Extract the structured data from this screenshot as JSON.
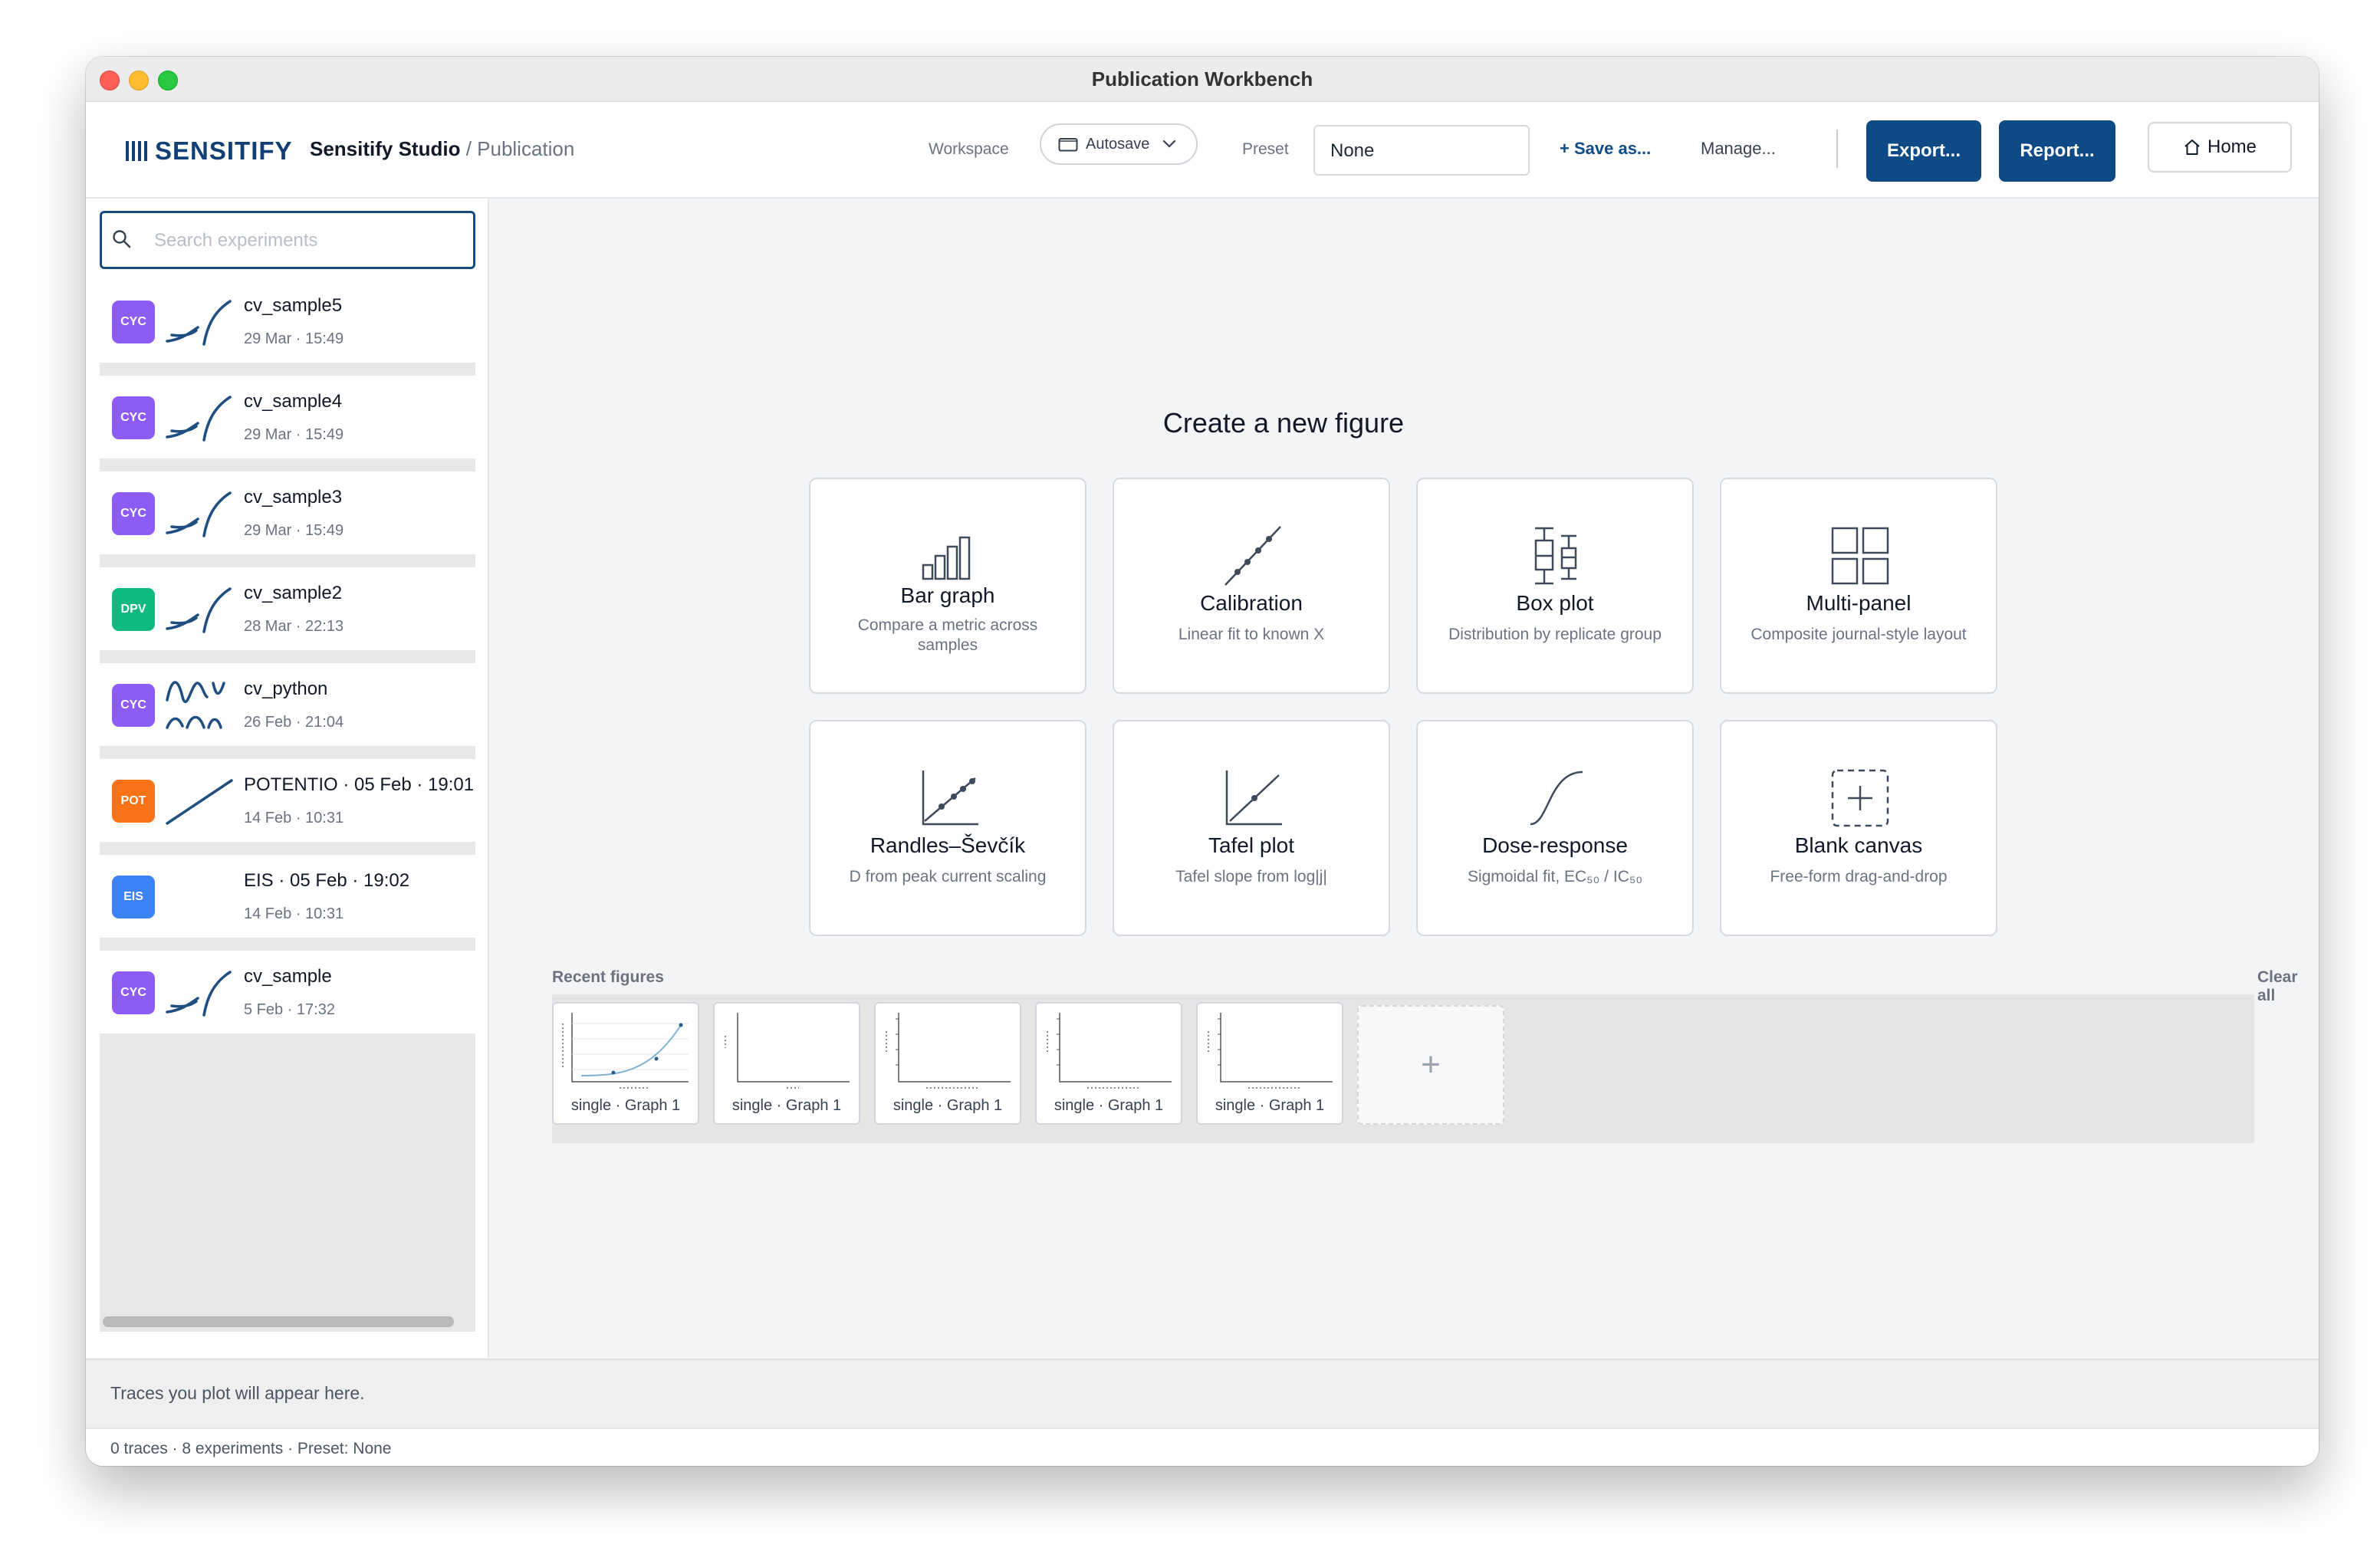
{
  "window": {
    "title": "Publication Workbench"
  },
  "header": {
    "logo_text": "SENSITIFY",
    "breadcrumb_app": "Sensitify Studio",
    "breadcrumb_page": " / Publication",
    "workspace_label": "Workspace",
    "workspace_value": "Autosave",
    "preset_label": "Preset",
    "preset_value": "None",
    "save_as": "+ Save as...",
    "manage": "Manage...",
    "export": "Export...",
    "report": "Report...",
    "home": "Home"
  },
  "sidebar": {
    "search_placeholder": "Search experiments",
    "items": [
      {
        "badge": "CYC",
        "color": "#8b5cf6",
        "icon": "cv-trace-icon",
        "name": "cv_sample5",
        "date": "29 Mar · 15:49"
      },
      {
        "badge": "CYC",
        "color": "#8b5cf6",
        "icon": "cv-trace-icon",
        "name": "cv_sample4",
        "date": "29 Mar · 15:49"
      },
      {
        "badge": "CYC",
        "color": "#8b5cf6",
        "icon": "cv-trace-icon",
        "name": "cv_sample3",
        "date": "29 Mar · 15:49"
      },
      {
        "badge": "DPV",
        "color": "#10b981",
        "icon": "cv-trace-icon",
        "name": "cv_sample2",
        "date": "28 Mar · 22:13"
      },
      {
        "badge": "CYC",
        "color": "#8b5cf6",
        "icon": "wave-trace-icon",
        "name": "cv_python",
        "date": "26 Feb · 21:04"
      },
      {
        "badge": "POT",
        "color": "#f97316",
        "icon": "linear-trace-icon",
        "name": "POTENTIO · 05 Feb · 19:01",
        "date": "14 Feb · 10:31"
      },
      {
        "badge": "EIS",
        "color": "#3b82f6",
        "icon": "none",
        "name": "EIS · 05 Feb · 19:02",
        "date": "14 Feb · 10:31"
      },
      {
        "badge": "CYC",
        "color": "#8b5cf6",
        "icon": "cv-trace-icon",
        "name": "cv_sample",
        "date": "5 Feb · 17:32"
      }
    ]
  },
  "main": {
    "create_title": "Create a new figure",
    "templates": [
      {
        "title": "Bar graph",
        "subtitle": "Compare a metric across samples",
        "icon": "bar-graph-icon"
      },
      {
        "title": "Calibration",
        "subtitle": "Linear fit to known X",
        "icon": "calibration-icon"
      },
      {
        "title": "Box plot",
        "subtitle": "Distribution by replicate group",
        "icon": "box-plot-icon"
      },
      {
        "title": "Multi-panel",
        "subtitle": "Composite journal-style layout",
        "icon": "multi-panel-icon"
      },
      {
        "title": "Randles–Ševčík",
        "subtitle": "D from peak current scaling",
        "icon": "randles-icon"
      },
      {
        "title": "Tafel plot",
        "subtitle": "Tafel slope from log|j|",
        "icon": "tafel-icon"
      },
      {
        "title": "Dose-response",
        "subtitle": "Sigmoidal fit, EC₅₀ / IC₅₀",
        "icon": "sigmoid-icon"
      },
      {
        "title": "Blank canvas",
        "subtitle": "Free-form drag-and-drop",
        "icon": "blank-canvas-icon"
      }
    ],
    "recent_label": "Recent figures",
    "clear_all": "Clear all",
    "recent": [
      {
        "label": "single · Graph 1"
      },
      {
        "label": "single · Graph 1"
      },
      {
        "label": "single · Graph 1"
      },
      {
        "label": "single · Graph 1"
      },
      {
        "label": "single · Graph 1"
      }
    ],
    "add_label": "+"
  },
  "footer": {
    "traces_hint": "Traces you plot will appear here.",
    "status": "0 traces · 8 experiments · Preset: None"
  }
}
